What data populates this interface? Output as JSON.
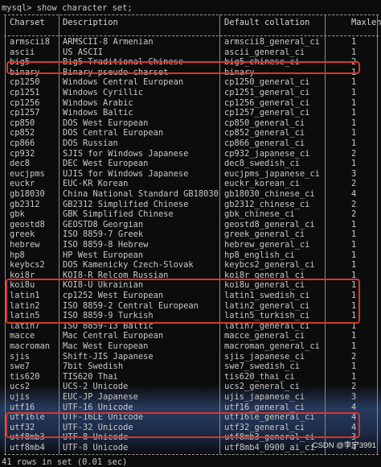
{
  "prompt": "mysql> show character set;",
  "headers": [
    "Charset",
    "Description",
    "Default collation",
    "Maxlen"
  ],
  "rows": [
    [
      "armscii8",
      "ARMSCII-8 Armenian",
      "armscii8_general_ci",
      "1"
    ],
    [
      "ascii",
      "US ASCII",
      "ascii_general_ci",
      "1"
    ],
    [
      "big5",
      "Big5 Traditional Chinese",
      "big5_chinese_ci",
      "2"
    ],
    [
      "binary",
      "Binary pseudo charset",
      "binary",
      "1"
    ],
    [
      "cp1250",
      "Windows Central European",
      "cp1250_general_ci",
      "1"
    ],
    [
      "cp1251",
      "Windows Cyrillic",
      "cp1251_general_ci",
      "1"
    ],
    [
      "cp1256",
      "Windows Arabic",
      "cp1256_general_ci",
      "1"
    ],
    [
      "cp1257",
      "Windows Baltic",
      "cp1257_general_ci",
      "1"
    ],
    [
      "cp850",
      "DOS West European",
      "cp850_general_ci",
      "1"
    ],
    [
      "cp852",
      "DOS Central European",
      "cp852_general_ci",
      "1"
    ],
    [
      "cp866",
      "DOS Russian",
      "cp866_general_ci",
      "1"
    ],
    [
      "cp932",
      "SJIS for Windows Japanese",
      "cp932_japanese_ci",
      "2"
    ],
    [
      "dec8",
      "DEC West European",
      "dec8_swedish_ci",
      "1"
    ],
    [
      "eucjpms",
      "UJIS for Windows Japanese",
      "eucjpms_japanese_ci",
      "3"
    ],
    [
      "euckr",
      "EUC-KR Korean",
      "euckr_korean_ci",
      "2"
    ],
    [
      "gb18030",
      "China National Standard GB18030",
      "gb18030_chinese_ci",
      "4"
    ],
    [
      "gb2312",
      "GB2312 Simplified Chinese",
      "gb2312_chinese_ci",
      "2"
    ],
    [
      "gbk",
      "GBK Simplified Chinese",
      "gbk_chinese_ci",
      "2"
    ],
    [
      "geostd8",
      "GEOSTD8 Georgian",
      "geostd8_general_ci",
      "1"
    ],
    [
      "greek",
      "ISO 8859-7 Greek",
      "greek_general_ci",
      "1"
    ],
    [
      "hebrew",
      "ISO 8859-8 Hebrew",
      "hebrew_general_ci",
      "1"
    ],
    [
      "hp8",
      "HP West European",
      "hp8_english_ci",
      "1"
    ],
    [
      "keybcs2",
      "DOS Kamenicky Czech-Slovak",
      "keybcs2_general_ci",
      "1"
    ],
    [
      "koi8r",
      "KOI8-R Relcom Russian",
      "koi8r_general_ci",
      "1"
    ],
    [
      "koi8u",
      "KOI8-U Ukrainian",
      "koi8u_general_ci",
      "1"
    ],
    [
      "latin1",
      "cp1252 West European",
      "latin1_swedish_ci",
      "1"
    ],
    [
      "latin2",
      "ISO 8859-2 Central European",
      "latin2_general_ci",
      "1"
    ],
    [
      "latin5",
      "ISO 8859-9 Turkish",
      "latin5_turkish_ci",
      "1"
    ],
    [
      "latin7",
      "ISO 8859-13 Baltic",
      "latin7_general_ci",
      "1"
    ],
    [
      "macce",
      "Mac Central European",
      "macce_general_ci",
      "1"
    ],
    [
      "macroman",
      "Mac West European",
      "macroman_general_ci",
      "1"
    ],
    [
      "sjis",
      "Shift-JIS Japanese",
      "sjis_japanese_ci",
      "2"
    ],
    [
      "swe7",
      "7bit Swedish",
      "swe7_swedish_ci",
      "1"
    ],
    [
      "tis620",
      "TIS620 Thai",
      "tis620_thai_ci",
      "1"
    ],
    [
      "ucs2",
      "UCS-2 Unicode",
      "ucs2_general_ci",
      "2"
    ],
    [
      "ujis",
      "EUC-JP Japanese",
      "ujis_japanese_ci",
      "3"
    ],
    [
      "utf16",
      "UTF-16 Unicode",
      "utf16_general_ci",
      "4"
    ],
    [
      "utf16le",
      "UTF-16LE Unicode",
      "utf16le_general_ci",
      "4"
    ],
    [
      "utf32",
      "UTF-32 Unicode",
      "utf32_general_ci",
      "4"
    ],
    [
      "utf8mb3",
      "UTF-8 Unicode",
      "utf8mb3_general_ci",
      "3"
    ],
    [
      "utf8mb4",
      "UTF-8 Unicode",
      "utf8mb4_0900_ai_ci",
      "4"
    ]
  ],
  "footer": "41 rows in set (0.01 sec)",
  "watermark": "CSDN @李宁3991",
  "highlight_color": "#d9362a"
}
